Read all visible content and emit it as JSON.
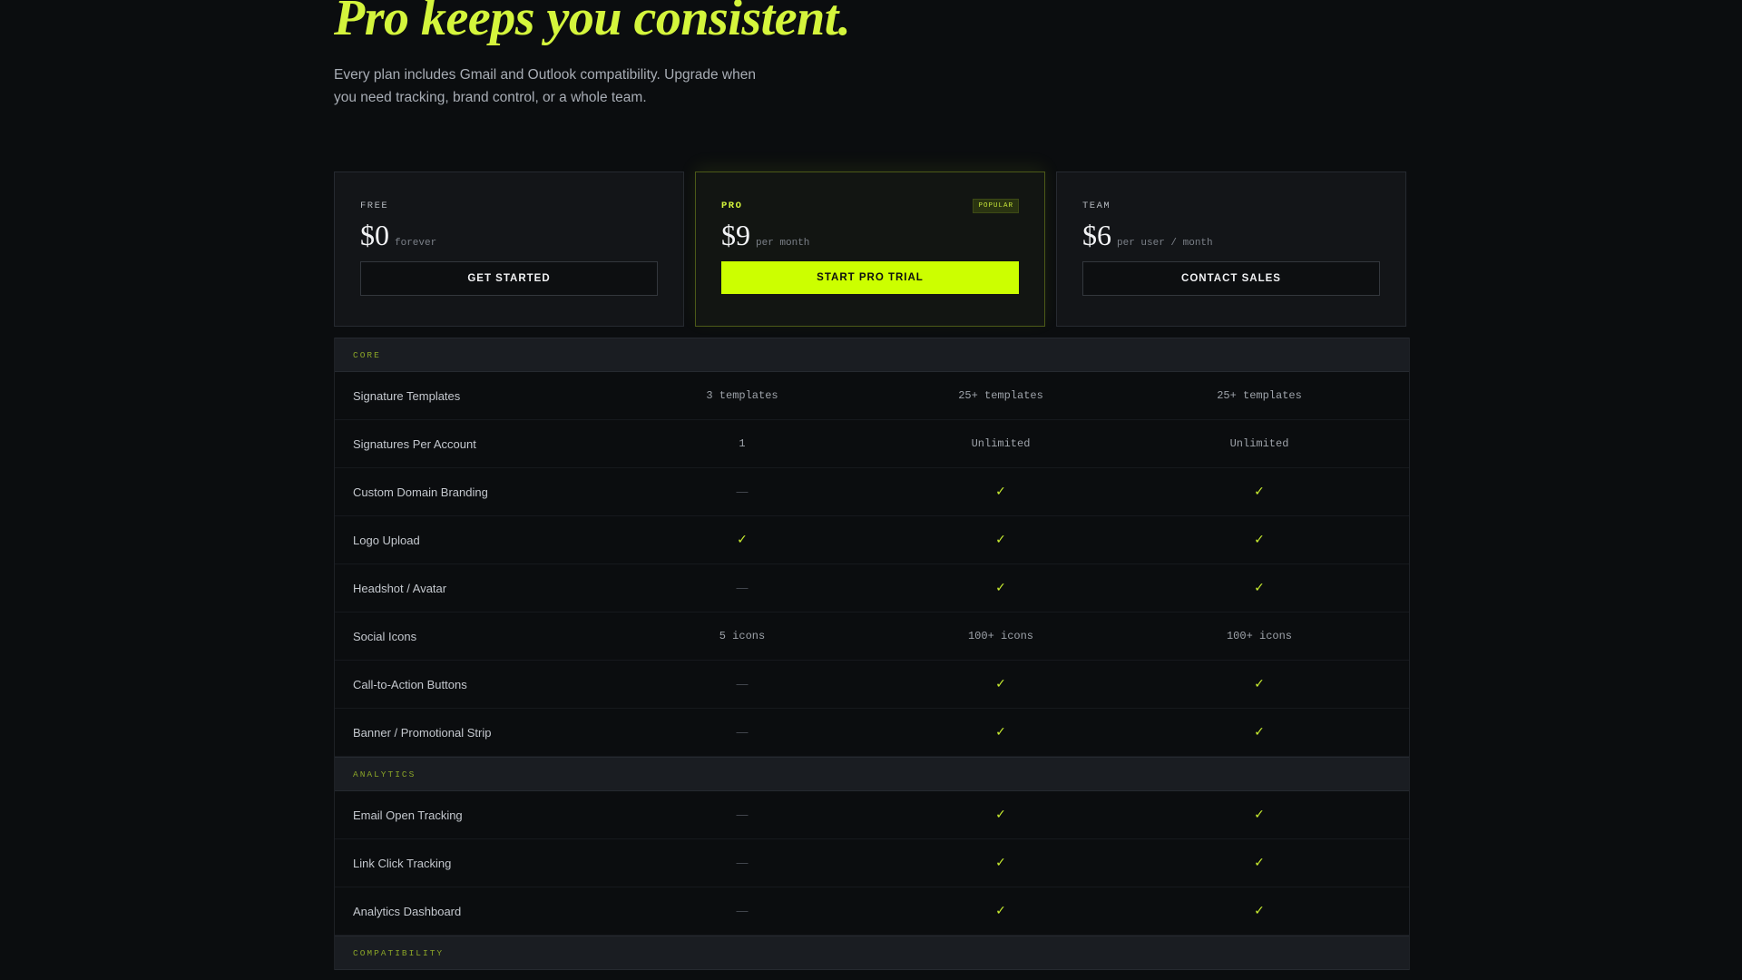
{
  "hero": {
    "title": "Pro keeps you consistent.",
    "subtitle": "Every plan includes Gmail and Outlook compatibility. Upgrade when you need tracking, brand control, or a whole team."
  },
  "plans": [
    {
      "name": "FREE",
      "price": "$0",
      "period": "forever",
      "button": "GET STARTED"
    },
    {
      "name": "PRO",
      "badge": "POPULAR",
      "price": "$9",
      "period": "per month",
      "button": "START PRO TRIAL"
    },
    {
      "name": "TEAM",
      "price": "$6",
      "period": "per user / month",
      "button": "CONTACT SALES"
    }
  ],
  "sections": [
    {
      "title": "CORE",
      "rows": [
        {
          "feature": "Signature Templates",
          "values": [
            "3 templates",
            "25+ templates",
            "25+ templates"
          ]
        },
        {
          "feature": "Signatures Per Account",
          "values": [
            "1",
            "Unlimited",
            "Unlimited"
          ]
        },
        {
          "feature": "Custom Domain Branding",
          "values": [
            "—",
            "✓",
            "✓"
          ]
        },
        {
          "feature": "Logo Upload",
          "values": [
            "✓",
            "✓",
            "✓"
          ]
        },
        {
          "feature": "Headshot / Avatar",
          "values": [
            "—",
            "✓",
            "✓"
          ]
        },
        {
          "feature": "Social Icons",
          "values": [
            "5 icons",
            "100+ icons",
            "100+ icons"
          ]
        },
        {
          "feature": "Call-to-Action Buttons",
          "values": [
            "—",
            "✓",
            "✓"
          ]
        },
        {
          "feature": "Banner / Promotional Strip",
          "values": [
            "—",
            "✓",
            "✓"
          ]
        }
      ]
    },
    {
      "title": "ANALYTICS",
      "rows": [
        {
          "feature": "Email Open Tracking",
          "values": [
            "—",
            "✓",
            "✓"
          ]
        },
        {
          "feature": "Link Click Tracking",
          "values": [
            "—",
            "✓",
            "✓"
          ]
        },
        {
          "feature": "Analytics Dashboard",
          "values": [
            "—",
            "✓",
            "✓"
          ]
        }
      ]
    },
    {
      "title": "COMPATIBILITY",
      "rows": []
    }
  ],
  "colors": {
    "accent": "#ccff00",
    "background": "#0b0d0f",
    "card": "#131518"
  }
}
